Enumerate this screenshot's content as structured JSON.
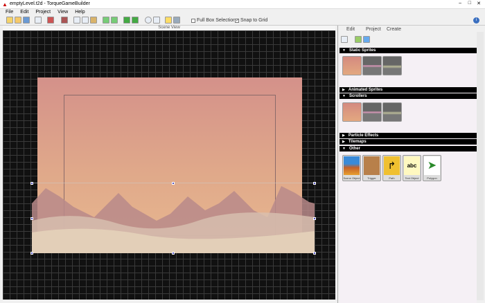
{
  "window": {
    "title": "emptyLevel.t2d - TorqueGameBuilder"
  },
  "menu": [
    "File",
    "Edit",
    "Project",
    "View",
    "Help"
  ],
  "toolbar": {
    "full_box_selection": "Full Box Selection",
    "full_box_checked": false,
    "snap_to_grid": "Snap to Grid",
    "snap_checked": true
  },
  "scene": {
    "header": "Scene View"
  },
  "panel": {
    "tabs": [
      "Edit",
      "Project",
      "Create"
    ],
    "active_tab": "Create",
    "sections": {
      "static": "Static Sprites",
      "animated": "Animated Sprites",
      "scrollers": "Scrollers",
      "particles": "Particle Effects",
      "tilemaps": "Tilemaps",
      "other": "Other"
    },
    "other_items": [
      "Scene Object",
      "Trigger",
      "Path",
      "Text Object",
      "Polygon"
    ]
  }
}
